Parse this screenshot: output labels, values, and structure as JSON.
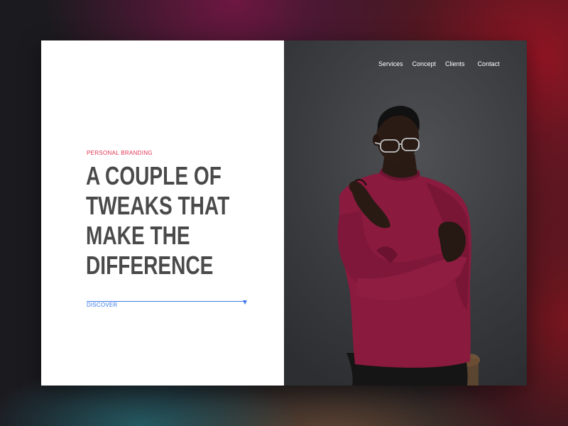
{
  "nav": {
    "items": [
      {
        "label": "Services"
      },
      {
        "label": "Concept"
      },
      {
        "label": "Clients"
      },
      {
        "label": "Contact"
      }
    ]
  },
  "hero": {
    "eyebrow": "PERSONAL BRANDING",
    "headline_lines": [
      "A COUPLE OF",
      "TWEAKS THAT",
      "MAKE THE",
      "DIFFERENCE"
    ],
    "cta_label": "DISCOVER"
  },
  "colors": {
    "accent_red": "#e0344f",
    "accent_blue": "#3d7be8",
    "headline_gray": "#4a4a4a",
    "sweater": "#8a1a3e"
  },
  "icons": {
    "cta": "arrow-down-icon"
  }
}
